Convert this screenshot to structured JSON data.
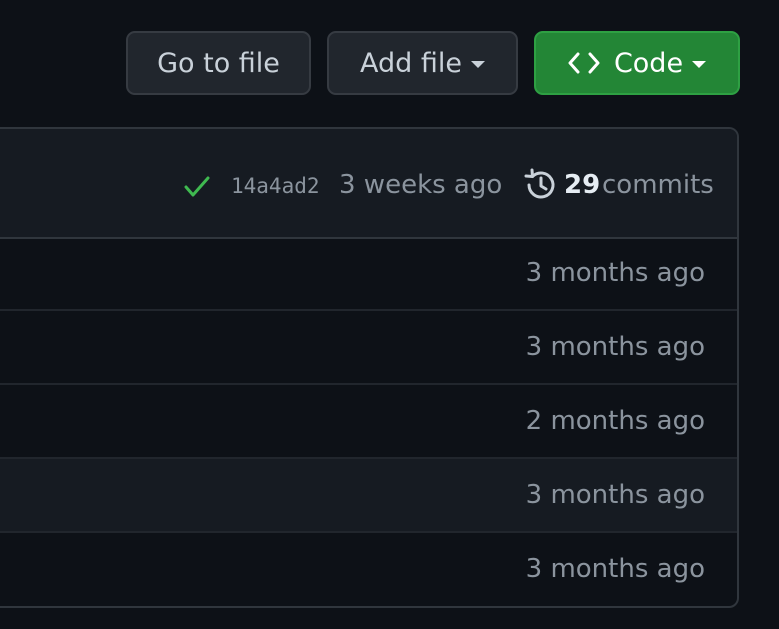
{
  "toolbar": {
    "go_to_file_label": "Go to file",
    "add_file_label": "Add file",
    "code_label": "Code"
  },
  "latest_commit": {
    "sha": "14a4ad2",
    "time": "3 weeks ago",
    "count": "29",
    "count_label": "commits",
    "status": "success",
    "status_color": "#3fb950"
  },
  "files": [
    {
      "time": "3 months ago"
    },
    {
      "time": "3 months ago"
    },
    {
      "time": "2 months ago"
    },
    {
      "time": "3 months ago"
    },
    {
      "time": "3 months ago"
    }
  ],
  "icons": {
    "code": "code-brackets",
    "caret": "triangle-down",
    "status": "check",
    "history": "history-clock"
  },
  "colors": {
    "background": "#0d1117",
    "primary_button": "#238636",
    "border": "#30363d",
    "muted_text": "#8b949e"
  }
}
